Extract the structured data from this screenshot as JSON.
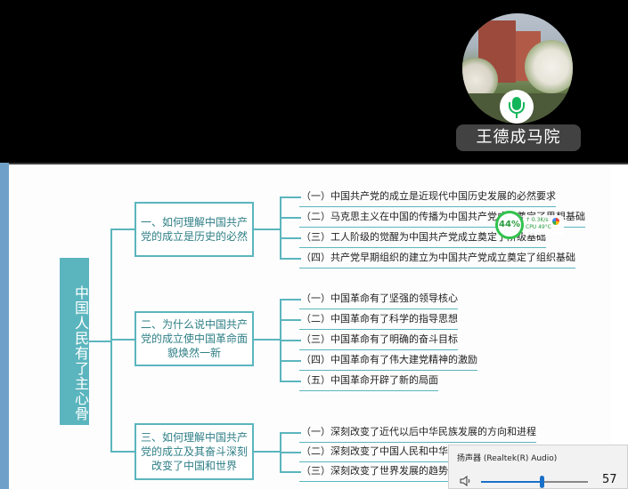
{
  "participant": {
    "name": "王德成马院"
  },
  "mindmap": {
    "root": "中国人民有了主心骨",
    "branches": [
      {
        "label": "一、如何理解中国共产党的成立是历史的必然",
        "items": [
          "（一）中国共产党的成立是近现代中国历史发展的必然要求",
          "（二）马克思主义在中国的传播为中国共产党成立奠定了思想基础",
          "（三）工人阶级的觉醒为中国共产党成立奠定了阶级基础",
          "（四）共产党早期组织的建立为中国共产党成立奠定了组织基础"
        ]
      },
      {
        "label": "二、为什么说中国共产党的成立使中国革命面貌焕然一新",
        "items": [
          "（一）中国革命有了坚强的领导核心",
          "（二）中国革命有了科学的指导思想",
          "（三）中国革命有了明确的奋斗目标",
          "（四）中国革命有了伟大建党精神的激励",
          "（五）中国革命开辟了新的局面"
        ]
      },
      {
        "label": "三、如何理解中国共产党的成立及其奋斗深刻改变了中国和世界",
        "items": [
          "（一）深刻改变了近代以后中华民族发展的方向和进程",
          "（二）深刻改变了中国人民和中华",
          "（三）深刻改变了世界发展的趋势"
        ]
      }
    ]
  },
  "perf_widget": {
    "percent": "44%",
    "net_up": "↑ 0.3K/s",
    "net_down": "↓ 0.5K/s",
    "cpu": "CPU 49°C"
  },
  "volume": {
    "title": "扬声器 (Realtek(R) Audio)",
    "value": "57",
    "level": 0.57
  },
  "colors": {
    "accent": "#5bb5be",
    "mic_green": "#12b65a",
    "volume_blue": "#1a6fc8"
  }
}
